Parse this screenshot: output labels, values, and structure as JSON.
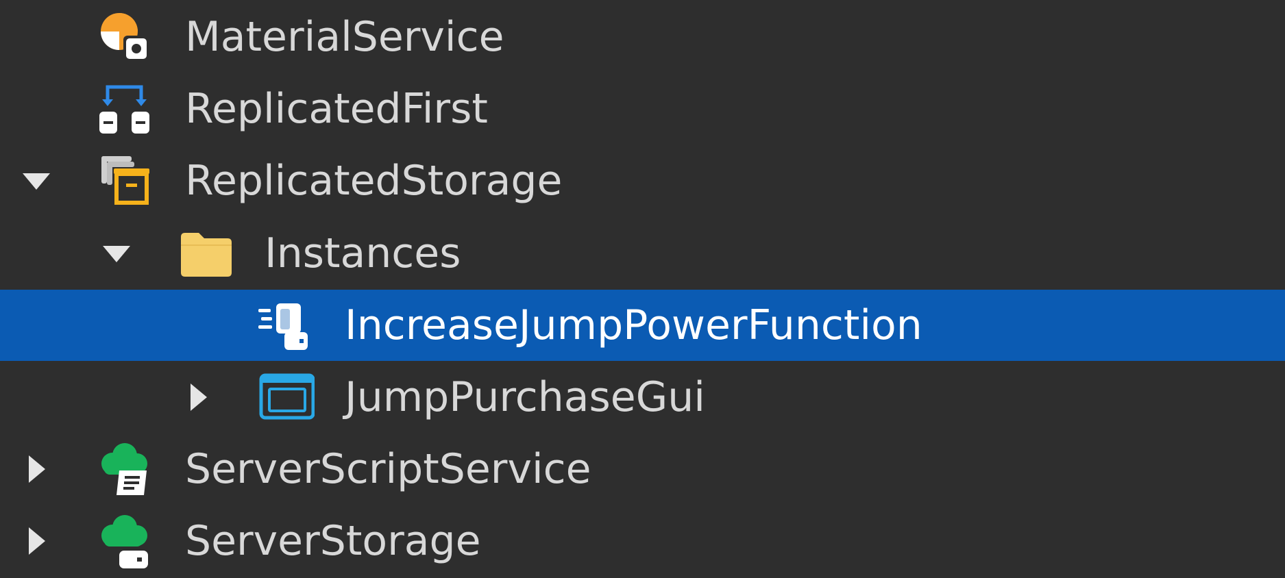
{
  "explorer": {
    "items": [
      {
        "label": "MaterialService",
        "icon": "material-service-icon",
        "expanded": null
      },
      {
        "label": "ReplicatedFirst",
        "icon": "replicated-first-icon",
        "expanded": null
      },
      {
        "label": "ReplicatedStorage",
        "icon": "replicated-storage-icon",
        "expanded": true
      },
      {
        "label": "Instances",
        "icon": "folder-icon",
        "expanded": true
      },
      {
        "label": "IncreaseJumpPowerFunction",
        "icon": "remote-function-icon",
        "expanded": null,
        "selected": true
      },
      {
        "label": "JumpPurchaseGui",
        "icon": "screen-gui-icon",
        "expanded": false
      },
      {
        "label": "ServerScriptService",
        "icon": "server-script-service-icon",
        "expanded": false
      },
      {
        "label": "ServerStorage",
        "icon": "server-storage-icon",
        "expanded": false
      }
    ]
  },
  "colors": {
    "background": "#2e2e2e",
    "selection": "#0b5bb3",
    "text": "#d8d8d8",
    "selected_text": "#ffffff",
    "folder": "#f5cf6a",
    "accent_orange": "#f6a02d",
    "accent_green": "#19b35a",
    "accent_blue": "#2f8ae8",
    "gui_blue": "#29a8e6"
  }
}
